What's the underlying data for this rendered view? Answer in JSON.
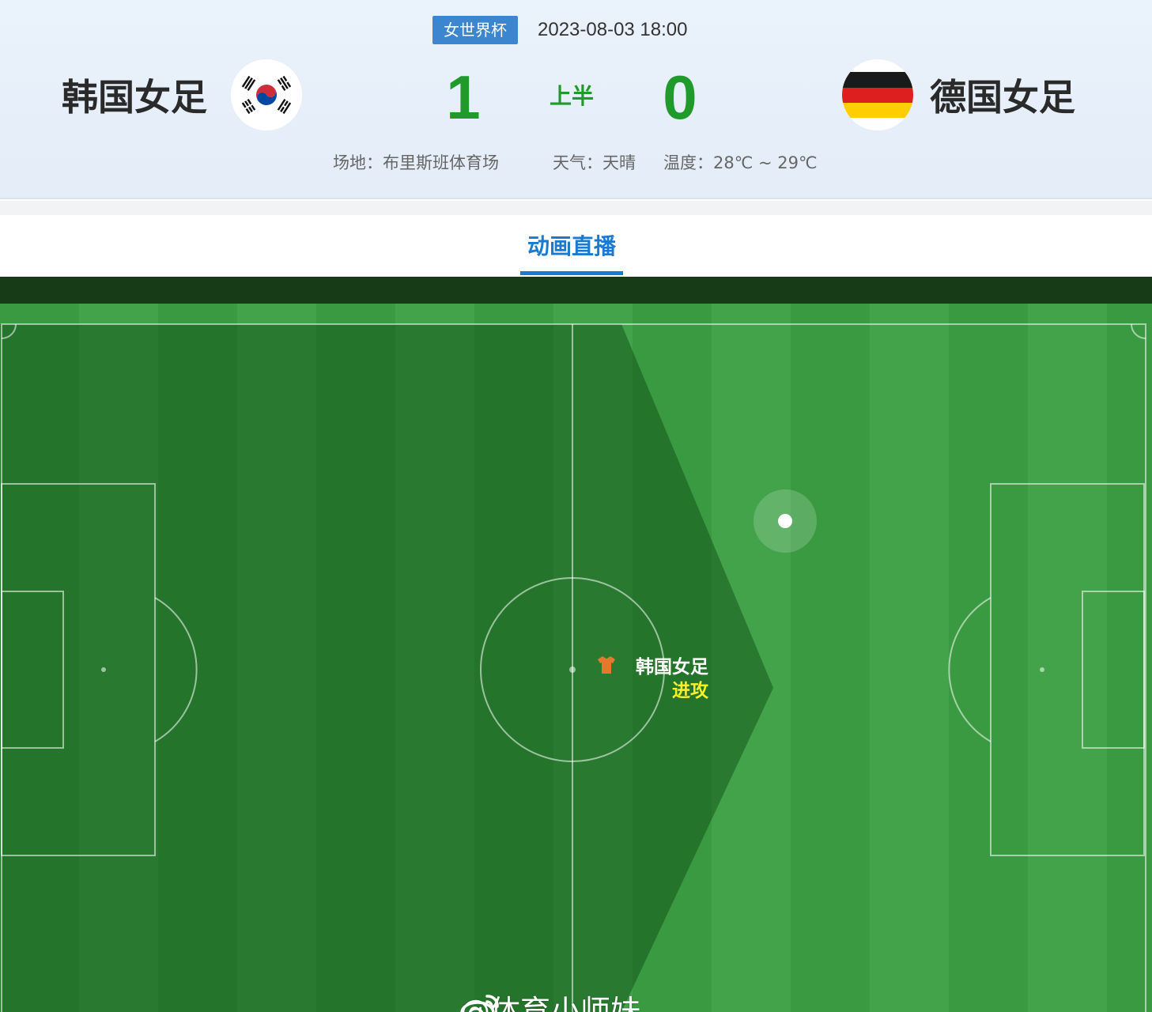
{
  "match": {
    "league": "女世界杯",
    "datetime": "2023-08-03 18:00",
    "period": "上半",
    "home": {
      "name": "韩国女足",
      "score": "1",
      "flag_icon": "south-korea-flag-icon"
    },
    "away": {
      "name": "德国女足",
      "score": "0",
      "flag_icon": "germany-flag-icon"
    },
    "venue": "场地：布里斯班体育场",
    "weather": "天气：天晴",
    "temperature": "温度：28℃ ~ 29℃"
  },
  "tabs": {
    "active_label": "动画直播"
  },
  "live": {
    "event_team": "韩国女足",
    "event_action": "进攻",
    "event_icon": "jersey-icon",
    "event_color": "#f6ef2c",
    "shirt_color": "#e8772e"
  },
  "watermark": {
    "text": "@体育小师妹",
    "icon": "weibo-icon"
  },
  "colors": {
    "score_green": "#1f9a2b",
    "tab_blue": "#1a7ad0",
    "badge_blue": "#3c86d0"
  }
}
